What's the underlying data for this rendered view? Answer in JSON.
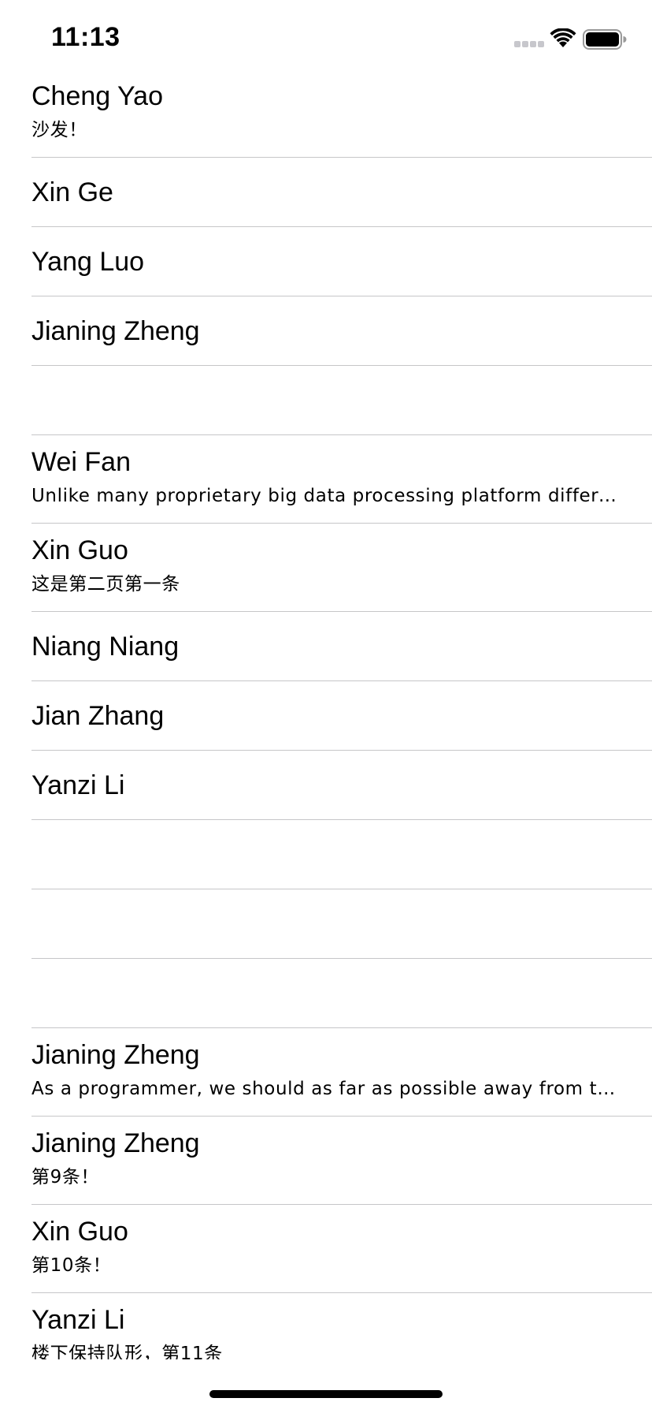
{
  "status_bar": {
    "time": "11:13",
    "icons": [
      "signal-dots-icon",
      "wifi-icon",
      "battery-icon"
    ]
  },
  "list": {
    "items": [
      {
        "title": "Cheng Yao",
        "subtitle": "沙发！"
      },
      {
        "title": "Xin Ge",
        "subtitle": ""
      },
      {
        "title": "Yang Luo",
        "subtitle": ""
      },
      {
        "title": "Jianing Zheng",
        "subtitle": ""
      },
      {
        "title": "",
        "subtitle": ""
      },
      {
        "title": "Wei Fan",
        "subtitle": "Unlike many proprietary big data processing platform different,..."
      },
      {
        "title": "Xin Guo",
        "subtitle": "这是第二页第一条"
      },
      {
        "title": "Niang Niang",
        "subtitle": ""
      },
      {
        "title": "Jian Zhang",
        "subtitle": ""
      },
      {
        "title": "Yanzi Li",
        "subtitle": ""
      },
      {
        "title": "",
        "subtitle": ""
      },
      {
        "title": "",
        "subtitle": ""
      },
      {
        "title": "",
        "subtitle": ""
      },
      {
        "title": "Jianing Zheng",
        "subtitle": "As a programmer, we should as far as possible away from the Wi..."
      },
      {
        "title": "Jianing Zheng",
        "subtitle": "第9条！"
      },
      {
        "title": "Xin Guo",
        "subtitle": "第10条！"
      },
      {
        "title": "Yanzi Li",
        "subtitle": "楼下保持队形，第11条"
      }
    ]
  },
  "colors": {
    "separator": "#c6c6c8",
    "text": "#000000",
    "background": "#ffffff"
  }
}
